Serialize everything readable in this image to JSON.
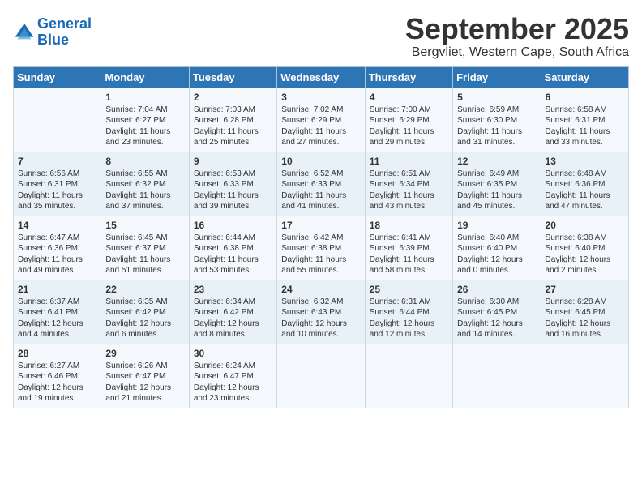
{
  "header": {
    "logo_line1": "General",
    "logo_line2": "Blue",
    "month": "September 2025",
    "location": "Bergvliet, Western Cape, South Africa"
  },
  "days_of_week": [
    "Sunday",
    "Monday",
    "Tuesday",
    "Wednesday",
    "Thursday",
    "Friday",
    "Saturday"
  ],
  "weeks": [
    [
      {
        "day": "",
        "content": ""
      },
      {
        "day": "1",
        "content": "Sunrise: 7:04 AM\nSunset: 6:27 PM\nDaylight: 11 hours\nand 23 minutes."
      },
      {
        "day": "2",
        "content": "Sunrise: 7:03 AM\nSunset: 6:28 PM\nDaylight: 11 hours\nand 25 minutes."
      },
      {
        "day": "3",
        "content": "Sunrise: 7:02 AM\nSunset: 6:29 PM\nDaylight: 11 hours\nand 27 minutes."
      },
      {
        "day": "4",
        "content": "Sunrise: 7:00 AM\nSunset: 6:29 PM\nDaylight: 11 hours\nand 29 minutes."
      },
      {
        "day": "5",
        "content": "Sunrise: 6:59 AM\nSunset: 6:30 PM\nDaylight: 11 hours\nand 31 minutes."
      },
      {
        "day": "6",
        "content": "Sunrise: 6:58 AM\nSunset: 6:31 PM\nDaylight: 11 hours\nand 33 minutes."
      }
    ],
    [
      {
        "day": "7",
        "content": "Sunrise: 6:56 AM\nSunset: 6:31 PM\nDaylight: 11 hours\nand 35 minutes."
      },
      {
        "day": "8",
        "content": "Sunrise: 6:55 AM\nSunset: 6:32 PM\nDaylight: 11 hours\nand 37 minutes."
      },
      {
        "day": "9",
        "content": "Sunrise: 6:53 AM\nSunset: 6:33 PM\nDaylight: 11 hours\nand 39 minutes."
      },
      {
        "day": "10",
        "content": "Sunrise: 6:52 AM\nSunset: 6:33 PM\nDaylight: 11 hours\nand 41 minutes."
      },
      {
        "day": "11",
        "content": "Sunrise: 6:51 AM\nSunset: 6:34 PM\nDaylight: 11 hours\nand 43 minutes."
      },
      {
        "day": "12",
        "content": "Sunrise: 6:49 AM\nSunset: 6:35 PM\nDaylight: 11 hours\nand 45 minutes."
      },
      {
        "day": "13",
        "content": "Sunrise: 6:48 AM\nSunset: 6:36 PM\nDaylight: 11 hours\nand 47 minutes."
      }
    ],
    [
      {
        "day": "14",
        "content": "Sunrise: 6:47 AM\nSunset: 6:36 PM\nDaylight: 11 hours\nand 49 minutes."
      },
      {
        "day": "15",
        "content": "Sunrise: 6:45 AM\nSunset: 6:37 PM\nDaylight: 11 hours\nand 51 minutes."
      },
      {
        "day": "16",
        "content": "Sunrise: 6:44 AM\nSunset: 6:38 PM\nDaylight: 11 hours\nand 53 minutes."
      },
      {
        "day": "17",
        "content": "Sunrise: 6:42 AM\nSunset: 6:38 PM\nDaylight: 11 hours\nand 55 minutes."
      },
      {
        "day": "18",
        "content": "Sunrise: 6:41 AM\nSunset: 6:39 PM\nDaylight: 11 hours\nand 58 minutes."
      },
      {
        "day": "19",
        "content": "Sunrise: 6:40 AM\nSunset: 6:40 PM\nDaylight: 12 hours\nand 0 minutes."
      },
      {
        "day": "20",
        "content": "Sunrise: 6:38 AM\nSunset: 6:40 PM\nDaylight: 12 hours\nand 2 minutes."
      }
    ],
    [
      {
        "day": "21",
        "content": "Sunrise: 6:37 AM\nSunset: 6:41 PM\nDaylight: 12 hours\nand 4 minutes."
      },
      {
        "day": "22",
        "content": "Sunrise: 6:35 AM\nSunset: 6:42 PM\nDaylight: 12 hours\nand 6 minutes."
      },
      {
        "day": "23",
        "content": "Sunrise: 6:34 AM\nSunset: 6:42 PM\nDaylight: 12 hours\nand 8 minutes."
      },
      {
        "day": "24",
        "content": "Sunrise: 6:32 AM\nSunset: 6:43 PM\nDaylight: 12 hours\nand 10 minutes."
      },
      {
        "day": "25",
        "content": "Sunrise: 6:31 AM\nSunset: 6:44 PM\nDaylight: 12 hours\nand 12 minutes."
      },
      {
        "day": "26",
        "content": "Sunrise: 6:30 AM\nSunset: 6:45 PM\nDaylight: 12 hours\nand 14 minutes."
      },
      {
        "day": "27",
        "content": "Sunrise: 6:28 AM\nSunset: 6:45 PM\nDaylight: 12 hours\nand 16 minutes."
      }
    ],
    [
      {
        "day": "28",
        "content": "Sunrise: 6:27 AM\nSunset: 6:46 PM\nDaylight: 12 hours\nand 19 minutes."
      },
      {
        "day": "29",
        "content": "Sunrise: 6:26 AM\nSunset: 6:47 PM\nDaylight: 12 hours\nand 21 minutes."
      },
      {
        "day": "30",
        "content": "Sunrise: 6:24 AM\nSunset: 6:47 PM\nDaylight: 12 hours\nand 23 minutes."
      },
      {
        "day": "",
        "content": ""
      },
      {
        "day": "",
        "content": ""
      },
      {
        "day": "",
        "content": ""
      },
      {
        "day": "",
        "content": ""
      }
    ]
  ]
}
